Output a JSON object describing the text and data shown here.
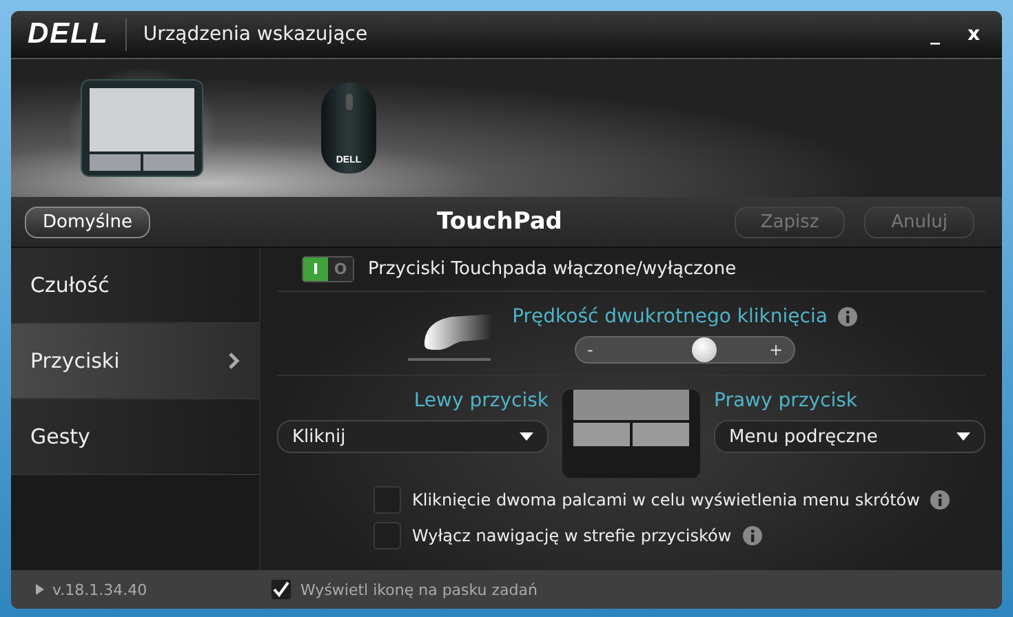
{
  "window": {
    "logo": "DELL",
    "title": "Urządzenia wskazujące",
    "minimize": "_",
    "close": "x"
  },
  "devices": [
    {
      "kind": "touchpad",
      "selected": true
    },
    {
      "kind": "mouse",
      "selected": false,
      "label": "DELL"
    }
  ],
  "header": {
    "title": "TouchPad",
    "buttons": [
      {
        "label": "Domyślne",
        "disabled": false
      },
      {
        "label": "Zapisz",
        "disabled": true
      },
      {
        "label": "Anuluj",
        "disabled": true
      }
    ]
  },
  "sidebar": {
    "items": [
      {
        "label": "Czułość",
        "selected": false
      },
      {
        "label": "Przyciski",
        "selected": true
      },
      {
        "label": "Gesty",
        "selected": false
      }
    ]
  },
  "buttons_toggle": {
    "on": true,
    "on_label": "I",
    "off_label": "O",
    "label": "Przyciski Touchpada włączone/wyłączone"
  },
  "double_click": {
    "title": "Prędkość dwukrotnego kliknięcia",
    "minus": "-",
    "plus": "+",
    "level": 0.6
  },
  "left_button": {
    "label": "Lewy przycisk",
    "value": "Kliknij"
  },
  "right_button": {
    "label": "Prawy przycisk",
    "value": "Menu podręczne"
  },
  "options": [
    {
      "label": "Kliknięcie dwoma palcami w celu wyświetlenia menu skrótów",
      "checked": false
    },
    {
      "label": "Wyłącz nawigację w strefie przycisków",
      "checked": false
    }
  ],
  "footer": {
    "version": "v.18.1.34.40",
    "show_icon": {
      "label": "Wyświetl ikonę na pasku zadań",
      "checked": true
    }
  }
}
